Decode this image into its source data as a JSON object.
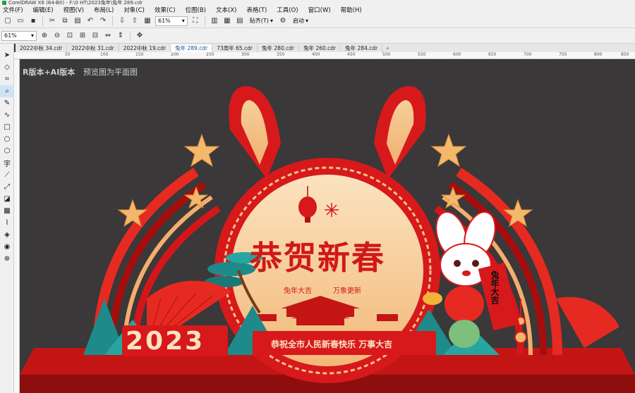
{
  "app": {
    "title": "CorelDRAW X6 (64-Bit) - F:\\0 HT\\2023兔年\\兔年 289.cdr"
  },
  "menu": [
    "文件(F)",
    "编辑(E)",
    "视图(V)",
    "布局(L)",
    "对象(C)",
    "效果(C)",
    "位图(B)",
    "文本(X)",
    "表格(T)",
    "工具(O)",
    "窗口(W)",
    "帮助(H)"
  ],
  "toolbar": {
    "zoom": "61%",
    "snap_label": "贴齐(T)",
    "launch_label": "启动"
  },
  "toolbar2": {
    "zoom": "61%"
  },
  "tabs": [
    {
      "label": "2022中秋 34.cdr",
      "active": false
    },
    {
      "label": "2022中秋 31.cdr",
      "active": false
    },
    {
      "label": "2022中秋 19.cdr",
      "active": false
    },
    {
      "label": "兔年 289.cdr",
      "active": true
    },
    {
      "label": "73周年 65.cdr",
      "active": false
    },
    {
      "label": "兔年 280.cdr",
      "active": false
    },
    {
      "label": "兔年 260.cdr",
      "active": false
    },
    {
      "label": "兔年 284.cdr",
      "active": false
    }
  ],
  "ruler": [
    "50",
    "100",
    "150",
    "200",
    "250",
    "300",
    "350",
    "400",
    "450",
    "500",
    "550",
    "600",
    "650",
    "700",
    "750",
    "800",
    "850"
  ],
  "canvas": {
    "note": "R版本+AI版本",
    "note2": "预览图为平面图",
    "headline": "恭贺新春",
    "sub_left": "兔年大吉",
    "sub_right": "万象更新",
    "year": "2023",
    "banner": "恭祝全市人民新春快乐  万事大吉",
    "scroll": "兔年大吉"
  },
  "colors": {
    "red": "#d7191c",
    "deep_red": "#b01010",
    "cream": "#f8d7a8",
    "gold": "#f2c27c",
    "teal": "#1f8a8a",
    "bg": "#3a3838"
  }
}
